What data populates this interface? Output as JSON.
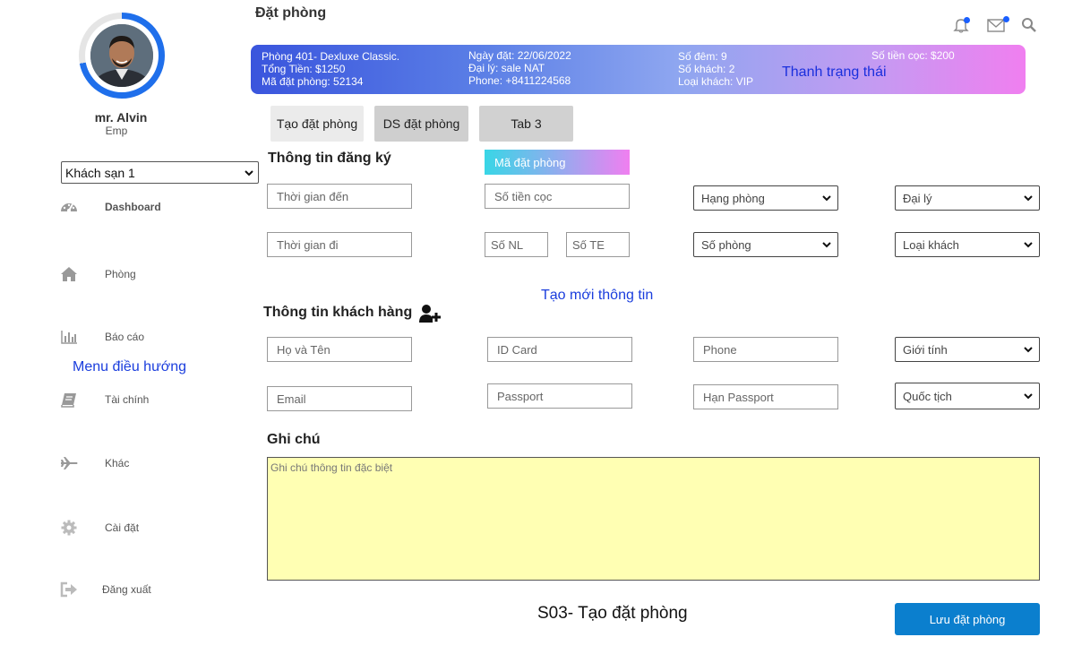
{
  "header": {
    "title": "Đặt phòng"
  },
  "user": {
    "name": "mr. Alvin",
    "role": "Emp"
  },
  "hotel_select": {
    "selected": "Khách sạn 1"
  },
  "sidebar": {
    "annotation": "Menu điều hướng",
    "items": [
      {
        "label": "Dashboard",
        "icon": "dashboard-icon"
      },
      {
        "label": "Phòng",
        "icon": "home-icon"
      },
      {
        "label": "Báo cáo",
        "icon": "bar-chart-icon"
      },
      {
        "label": "Tài chính",
        "icon": "book-icon"
      },
      {
        "label": "Khác",
        "icon": "plane-icon"
      },
      {
        "label": "Cài đặt",
        "icon": "gear-icon"
      },
      {
        "label": "Đăng xuất",
        "icon": "logout-icon"
      }
    ]
  },
  "status_bar": {
    "room": "Phòng 401- Dexluxe Classic.",
    "total": "Tổng Tiền: $1250",
    "booking_code": "Mã đặt phòng: 52134",
    "booking_date": "Ngày đặt: 22/06/2022",
    "agent": "Đại lý: sale NAT",
    "phone": "Phone: +8411224568",
    "nights": "Số đêm: 9",
    "guests": "Số khách: 2",
    "guest_type": "Loại khách: VIP",
    "deposit": "Số tiền cọc: $200",
    "annotation": "Thanh trạng thái"
  },
  "tabs": [
    {
      "label": "Tạo đặt phòng"
    },
    {
      "label": "DS đặt phòng"
    },
    {
      "label": "Tab 3"
    }
  ],
  "registration": {
    "title": "Thông tin đăng ký",
    "code_chip": "Mã đặt phòng",
    "arrival_placeholder": "Thời gian đến",
    "departure_placeholder": "Thời gian đi",
    "deposit_placeholder": "Số tiền cọc",
    "adults_placeholder": "Số NL",
    "children_placeholder": "Số TE",
    "room_class": "Hạng phòng",
    "room_number": "Số phòng",
    "agent": "Đại lý",
    "guest_type": "Loại khách"
  },
  "new_info_link": "Tạo mới thông tin",
  "customer": {
    "title": "Thông tin khách hàng",
    "name_placeholder": "Họ và Tên",
    "id_placeholder": "ID Card",
    "phone_placeholder": "Phone",
    "gender": "Giới tính",
    "email_placeholder": "Email",
    "passport_placeholder": "Passport",
    "passport_expiry_placeholder": "Hạn Passport",
    "nationality": "Quốc tịch"
  },
  "notes": {
    "title": "Ghi chú",
    "placeholder": "Ghi chú thông tin đặc biệt"
  },
  "caption": "S03- Tạo đặt phòng",
  "save_button": "Lưu đặt phòng",
  "colors": {
    "accent": "#0b7fce",
    "note_bg": "#ffffb3",
    "annotation": "#1a3ddd"
  }
}
